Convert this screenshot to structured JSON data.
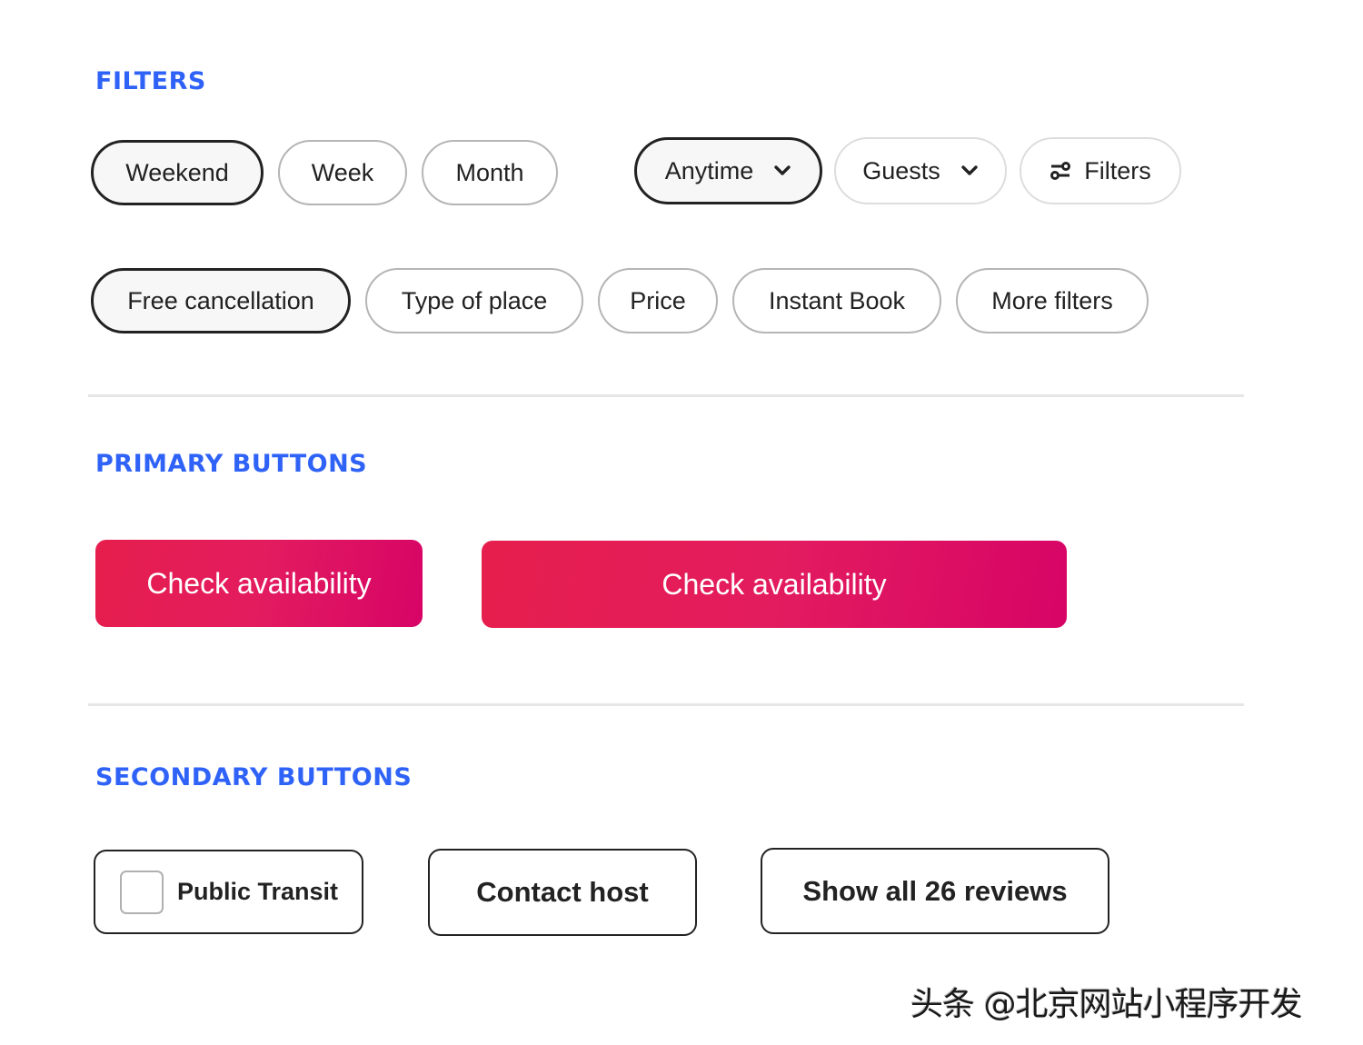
{
  "colors": {
    "section_title": "#2f62f7",
    "selected_border": "#222222",
    "selected_fill": "#f7f7f7",
    "pill_border": "#b5b5b5",
    "primary_gradient_start": "#e61e4d",
    "primary_gradient_end": "#d70466",
    "text": "#222222"
  },
  "filters": {
    "title": "FILTERS",
    "row1": [
      {
        "label": "Weekend",
        "selected": true
      },
      {
        "label": "Week",
        "selected": false
      },
      {
        "label": "Month",
        "selected": false
      }
    ],
    "dropdowns": [
      {
        "label": "Anytime",
        "icon": "chevron-down-icon",
        "selected": true
      },
      {
        "label": "Guests",
        "icon": "chevron-down-icon",
        "selected": false
      },
      {
        "label": "Filters",
        "icon": "sliders-icon",
        "selected": false
      }
    ],
    "row2": [
      {
        "label": "Free cancellation",
        "selected": true
      },
      {
        "label": "Type of place",
        "selected": false
      },
      {
        "label": "Price",
        "selected": false
      },
      {
        "label": "Instant Book",
        "selected": false
      },
      {
        "label": "More filters",
        "selected": false
      }
    ]
  },
  "primary_buttons": {
    "title": "PRIMARY BUTTONS",
    "buttons": [
      {
        "label": "Check availability"
      },
      {
        "label": "Check availability"
      }
    ]
  },
  "secondary_buttons": {
    "title": "SECONDARY BUTTONS",
    "checkbox_button": {
      "label": "Public Transit",
      "checked": false
    },
    "buttons": [
      {
        "label": "Contact host"
      },
      {
        "label": "Show all 26 reviews"
      }
    ]
  },
  "watermark": "头条 @北京网站小程序开发"
}
